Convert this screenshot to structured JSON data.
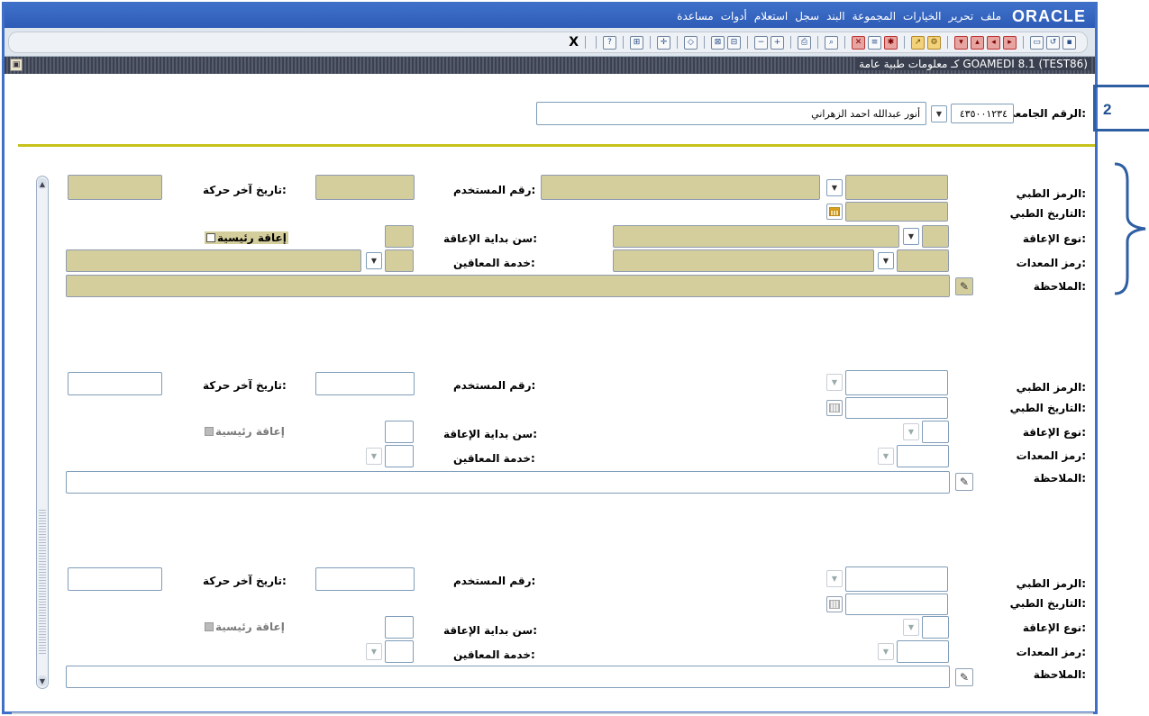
{
  "menu": {
    "logo": "ORACLE",
    "items": [
      "ملف",
      "تحرير",
      "الخيارات",
      "المجموعة",
      "البند",
      "سجل",
      "استعلام",
      "أدوات",
      "مساعدة"
    ]
  },
  "toolbar": {
    "exit_label": "X",
    "icons": [
      "save-icon",
      "rollback-icon",
      "print-preview-icon",
      "next-record-icon",
      "previous-record-icon",
      "next-block-icon",
      "previous-block-icon",
      "options-icon",
      "help-arrow-icon",
      "select-icon",
      "list-values-icon",
      "execute-query-icon",
      "enter-query-icon",
      "clear-record-icon",
      "print-icon",
      "insert-record-icon",
      "delete-record-icon",
      "clear-form-icon",
      "remove-record-icon",
      "search-icon",
      "pin-icon",
      "lock-icon",
      "help-icon"
    ]
  },
  "form_title": "كـ معلومات طبية عامة  GOAMEDI 8.1  (TEST86)",
  "key_block": {
    "id_label": "الرقم الجامعي:",
    "id_value": "٤٣٥٠٠١٢٣٤",
    "name_value": "أنور عبدالله احمد الزهراني"
  },
  "labels": {
    "med_code": "الرمز الطبي:",
    "med_date": "التاريخ الطبي:",
    "disability_type": "نوع الإعاقة:",
    "equipment_code": "رمز المعدات:",
    "note": "الملاحظة:",
    "user_id": "رقم المستخدم:",
    "last_activity": "تاريخ آخر حركة:",
    "onset_age": "سن بداية الإعاقة:",
    "disabled_service": "خدمة المعاقين:",
    "primary_disability": "إعاقة رئيسية"
  },
  "records": [
    {
      "med_code": "",
      "med_date": "",
      "disability_type": "",
      "equipment_code": "",
      "note": "",
      "user_id": "",
      "last_activity": "",
      "onset_age": "",
      "disabled_service": "",
      "primary_disability": false
    },
    {
      "med_code": "",
      "med_date": "",
      "disability_type": "",
      "equipment_code": "",
      "note": "",
      "user_id": "",
      "last_activity": "",
      "onset_age": "",
      "disabled_service": "",
      "primary_disability": false
    },
    {
      "med_code": "",
      "med_date": "",
      "disability_type": "",
      "equipment_code": "",
      "note": "",
      "user_id": "",
      "last_activity": "",
      "onset_age": "",
      "disabled_service": "",
      "primary_disability": false
    }
  ],
  "annotation": {
    "number": "2",
    "color": "#2e5fa3"
  },
  "colors": {
    "active_field": "#d4cd9c",
    "window_border": "#3f6fc6",
    "separator": "#c6c21a"
  }
}
